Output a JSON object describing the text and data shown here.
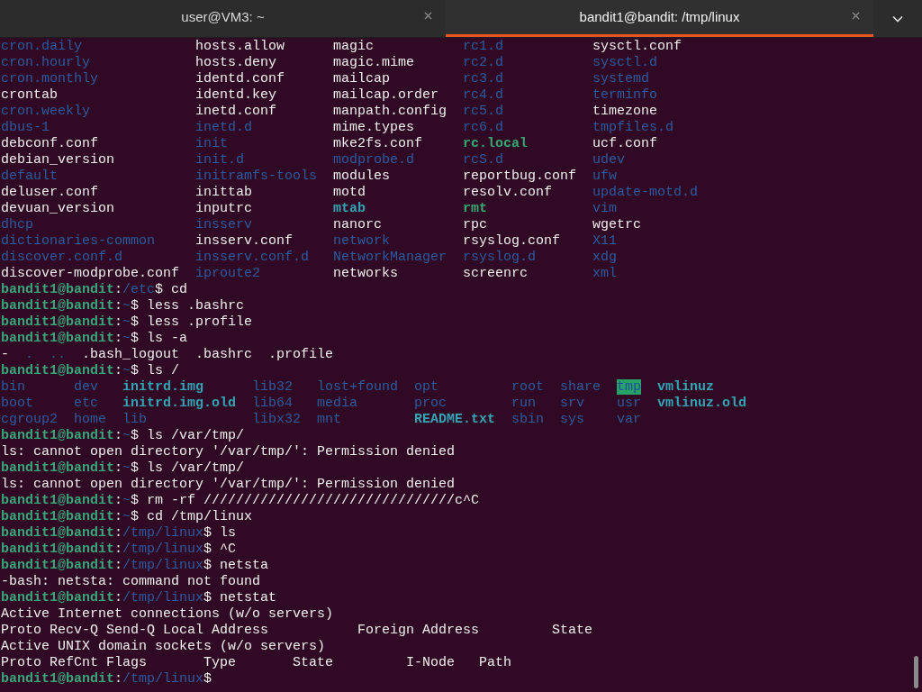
{
  "tabs": [
    {
      "title": "user@VM3: ~",
      "selected": false
    },
    {
      "title": "bandit1@bandit: /tmp/linux",
      "selected": true
    }
  ],
  "terminal": {
    "blocks": [
      {
        "kind": "listing",
        "rows": [
          [
            {
              "name": "cron.daily",
              "kind": "dir"
            },
            {
              "name": "hosts.allow",
              "kind": "file"
            },
            {
              "name": "magic",
              "kind": "file"
            },
            {
              "name": "rc1.d",
              "kind": "dir"
            },
            {
              "name": "sysctl.conf",
              "kind": "file"
            }
          ],
          [
            {
              "name": "cron.hourly",
              "kind": "dir"
            },
            {
              "name": "hosts.deny",
              "kind": "file"
            },
            {
              "name": "magic.mime",
              "kind": "file"
            },
            {
              "name": "rc2.d",
              "kind": "dir"
            },
            {
              "name": "sysctl.d",
              "kind": "dir"
            }
          ],
          [
            {
              "name": "cron.monthly",
              "kind": "dir"
            },
            {
              "name": "identd.conf",
              "kind": "file"
            },
            {
              "name": "mailcap",
              "kind": "file"
            },
            {
              "name": "rc3.d",
              "kind": "dir"
            },
            {
              "name": "systemd",
              "kind": "dir"
            }
          ],
          [
            {
              "name": "crontab",
              "kind": "file"
            },
            {
              "name": "identd.key",
              "kind": "file"
            },
            {
              "name": "mailcap.order",
              "kind": "file"
            },
            {
              "name": "rc4.d",
              "kind": "dir"
            },
            {
              "name": "terminfo",
              "kind": "dir"
            }
          ],
          [
            {
              "name": "cron.weekly",
              "kind": "dir"
            },
            {
              "name": "inetd.conf",
              "kind": "file"
            },
            {
              "name": "manpath.config",
              "kind": "file"
            },
            {
              "name": "rc5.d",
              "kind": "dir"
            },
            {
              "name": "timezone",
              "kind": "file"
            }
          ],
          [
            {
              "name": "dbus-1",
              "kind": "dir"
            },
            {
              "name": "inetd.d",
              "kind": "dir"
            },
            {
              "name": "mime.types",
              "kind": "file"
            },
            {
              "name": "rc6.d",
              "kind": "dir"
            },
            {
              "name": "tmpfiles.d",
              "kind": "dir"
            }
          ],
          [
            {
              "name": "debconf.conf",
              "kind": "file"
            },
            {
              "name": "init",
              "kind": "dir"
            },
            {
              "name": "mke2fs.conf",
              "kind": "file"
            },
            {
              "name": "rc.local",
              "kind": "exec"
            },
            {
              "name": "ucf.conf",
              "kind": "file"
            }
          ],
          [
            {
              "name": "debian_version",
              "kind": "file"
            },
            {
              "name": "init.d",
              "kind": "dir"
            },
            {
              "name": "modprobe.d",
              "kind": "dir"
            },
            {
              "name": "rcS.d",
              "kind": "dir"
            },
            {
              "name": "udev",
              "kind": "dir"
            }
          ],
          [
            {
              "name": "default",
              "kind": "dir"
            },
            {
              "name": "initramfs-tools",
              "kind": "dir"
            },
            {
              "name": "modules",
              "kind": "file"
            },
            {
              "name": "reportbug.conf",
              "kind": "file"
            },
            {
              "name": "ufw",
              "kind": "dir"
            }
          ],
          [
            {
              "name": "deluser.conf",
              "kind": "file"
            },
            {
              "name": "inittab",
              "kind": "file"
            },
            {
              "name": "motd",
              "kind": "file"
            },
            {
              "name": "resolv.conf",
              "kind": "file"
            },
            {
              "name": "update-motd.d",
              "kind": "dir"
            }
          ],
          [
            {
              "name": "devuan_version",
              "kind": "file"
            },
            {
              "name": "inputrc",
              "kind": "file"
            },
            {
              "name": "mtab",
              "kind": "link"
            },
            {
              "name": "rmt",
              "kind": "exec"
            },
            {
              "name": "vim",
              "kind": "dir"
            }
          ],
          [
            {
              "name": "dhcp",
              "kind": "dir"
            },
            {
              "name": "insserv",
              "kind": "dir"
            },
            {
              "name": "nanorc",
              "kind": "file"
            },
            {
              "name": "rpc",
              "kind": "file"
            },
            {
              "name": "wgetrc",
              "kind": "file"
            }
          ],
          [
            {
              "name": "dictionaries-common",
              "kind": "dir"
            },
            {
              "name": "insserv.conf",
              "kind": "file"
            },
            {
              "name": "network",
              "kind": "dir"
            },
            {
              "name": "rsyslog.conf",
              "kind": "file"
            },
            {
              "name": "X11",
              "kind": "dir"
            }
          ],
          [
            {
              "name": "discover.conf.d",
              "kind": "dir"
            },
            {
              "name": "insserv.conf.d",
              "kind": "dir"
            },
            {
              "name": "NetworkManager",
              "kind": "dir"
            },
            {
              "name": "rsyslog.d",
              "kind": "dir"
            },
            {
              "name": "xdg",
              "kind": "dir"
            }
          ],
          [
            {
              "name": "discover-modprobe.conf",
              "kind": "file"
            },
            {
              "name": "iproute2",
              "kind": "dir"
            },
            {
              "name": "networks",
              "kind": "file"
            },
            {
              "name": "screenrc",
              "kind": "file"
            },
            {
              "name": "xml",
              "kind": "dir"
            }
          ]
        ]
      },
      {
        "kind": "prompt",
        "user": "bandit1@bandit",
        "separator": ":",
        "path": "/etc",
        "command": "$ cd"
      },
      {
        "kind": "prompt",
        "user": "bandit1@bandit",
        "separator": ":",
        "path": "~",
        "command": "$ less .bashrc"
      },
      {
        "kind": "prompt",
        "user": "bandit1@bandit",
        "separator": ":",
        "path": "~",
        "command": "$ less .profile"
      },
      {
        "kind": "prompt",
        "user": "bandit1@bandit",
        "separator": ":",
        "path": "~",
        "command": "$ ls -a"
      },
      {
        "kind": "listing",
        "rows": [
          [
            {
              "name": "-",
              "kind": "file"
            },
            {
              "name": ".",
              "kind": "dir"
            },
            {
              "name": "..",
              "kind": "dir"
            },
            {
              "name": ".bash_logout",
              "kind": "file"
            },
            {
              "name": ".bashrc",
              "kind": "file"
            },
            {
              "name": ".profile",
              "kind": "file"
            }
          ]
        ]
      },
      {
        "kind": "prompt",
        "user": "bandit1@bandit",
        "separator": ":",
        "path": "~",
        "command": "$ ls /"
      },
      {
        "kind": "listing",
        "rows": [
          [
            {
              "name": "bin",
              "kind": "dir"
            },
            {
              "name": "dev",
              "kind": "dir"
            },
            {
              "name": "initrd.img",
              "kind": "link"
            },
            {
              "name": "lib32",
              "kind": "dir"
            },
            {
              "name": "lost+found",
              "kind": "dir"
            },
            {
              "name": "opt",
              "kind": "dir"
            },
            {
              "name": "root",
              "kind": "dir"
            },
            {
              "name": "share",
              "kind": "dir"
            },
            {
              "name": "tmp",
              "kind": "sticky"
            },
            {
              "name": "vmlinuz",
              "kind": "link"
            }
          ],
          [
            {
              "name": "boot",
              "kind": "dir"
            },
            {
              "name": "etc",
              "kind": "dir"
            },
            {
              "name": "initrd.img.old",
              "kind": "link"
            },
            {
              "name": "lib64",
              "kind": "dir"
            },
            {
              "name": "media",
              "kind": "dir"
            },
            {
              "name": "proc",
              "kind": "dir"
            },
            {
              "name": "run",
              "kind": "dir"
            },
            {
              "name": "srv",
              "kind": "dir"
            },
            {
              "name": "usr",
              "kind": "dir"
            },
            {
              "name": "vmlinuz.old",
              "kind": "link"
            }
          ],
          [
            {
              "name": "cgroup2",
              "kind": "dir"
            },
            {
              "name": "home",
              "kind": "dir"
            },
            {
              "name": "lib",
              "kind": "dir"
            },
            {
              "name": "libx32",
              "kind": "dir"
            },
            {
              "name": "mnt",
              "kind": "dir"
            },
            {
              "name": "README.txt",
              "kind": "link"
            },
            {
              "name": "sbin",
              "kind": "dir"
            },
            {
              "name": "sys",
              "kind": "dir"
            },
            {
              "name": "var",
              "kind": "dir"
            }
          ]
        ]
      },
      {
        "kind": "prompt",
        "user": "bandit1@bandit",
        "separator": ":",
        "path": "~",
        "command": "$ ls /var/tmp/"
      },
      {
        "kind": "output",
        "text": "ls: cannot open directory '/var/tmp/': Permission denied"
      },
      {
        "kind": "prompt",
        "user": "bandit1@bandit",
        "separator": ":",
        "path": "~",
        "command": "$ ls /var/tmp/"
      },
      {
        "kind": "output",
        "text": "ls: cannot open directory '/var/tmp/': Permission denied"
      },
      {
        "kind": "prompt",
        "user": "bandit1@bandit",
        "separator": ":",
        "path": "~",
        "command": "$ rm -rf ///////////////////////////////c^C"
      },
      {
        "kind": "prompt",
        "user": "bandit1@bandit",
        "separator": ":",
        "path": "~",
        "command": "$ cd /tmp/linux"
      },
      {
        "kind": "prompt",
        "user": "bandit1@bandit",
        "separator": ":",
        "path": "/tmp/linux",
        "command": "$ ls"
      },
      {
        "kind": "prompt",
        "user": "bandit1@bandit",
        "separator": ":",
        "path": "/tmp/linux",
        "command": "$ ^C"
      },
      {
        "kind": "prompt",
        "user": "bandit1@bandit",
        "separator": ":",
        "path": "/tmp/linux",
        "command": "$ netsta"
      },
      {
        "kind": "output",
        "text": "-bash: netsta: command not found"
      },
      {
        "kind": "prompt",
        "user": "bandit1@bandit",
        "separator": ":",
        "path": "/tmp/linux",
        "command": "$ netstat"
      },
      {
        "kind": "output",
        "text": "Active Internet connections (w/o servers)"
      },
      {
        "kind": "output",
        "text": "Proto Recv-Q Send-Q Local Address           Foreign Address         State"
      },
      {
        "kind": "output",
        "text": "Active UNIX domain sockets (w/o servers)"
      },
      {
        "kind": "output",
        "text": "Proto RefCnt Flags       Type       State         I-Node   Path"
      },
      {
        "kind": "prompt",
        "user": "bandit1@bandit",
        "separator": ":",
        "path": "/tmp/linux",
        "command": "$"
      }
    ]
  }
}
